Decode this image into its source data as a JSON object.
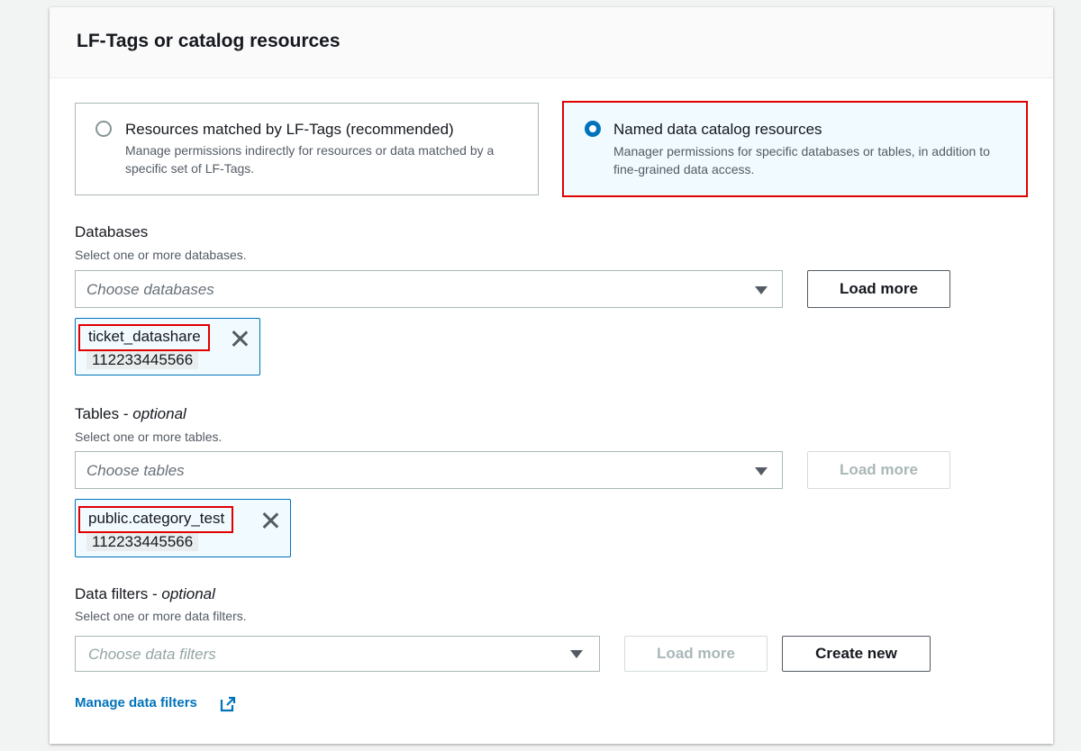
{
  "panel": {
    "title": "LF-Tags or catalog resources"
  },
  "resource_options": [
    {
      "label": "Resources matched by LF-Tags (recommended)",
      "description": "Manage permissions indirectly for resources or data matched by a specific set of LF-Tags.",
      "selected": false
    },
    {
      "label": "Named data catalog resources",
      "description": "Manager permissions for specific databases or tables, in addition to fine-grained data access.",
      "selected": true
    }
  ],
  "databases": {
    "label": "Databases",
    "description": "Select one or more databases.",
    "placeholder": "Choose databases",
    "load_more": "Load more",
    "selected_token": {
      "name": "ticket_datashare",
      "account": "112233445566"
    }
  },
  "tables": {
    "label": "Tables - ",
    "label_optional": "optional",
    "description": "Select one or more tables.",
    "placeholder": "Choose tables",
    "load_more": "Load more",
    "selected_token": {
      "name": "public.category_test",
      "account": "112233445566"
    }
  },
  "data_filters": {
    "label": "Data filters - ",
    "label_optional": "optional",
    "description": "Select one or more data filters.",
    "placeholder": "Choose data filters",
    "load_more": "Load more",
    "create_new": "Create new",
    "manage_link": "Manage data filters"
  },
  "icons": {
    "radio": "radio-icon",
    "caret": "caret-down-icon",
    "remove": "close-icon",
    "external": "external-link-icon"
  },
  "colors": {
    "accent": "#0073bb",
    "highlight": "#e00000",
    "selected_bg": "#f1faff"
  }
}
